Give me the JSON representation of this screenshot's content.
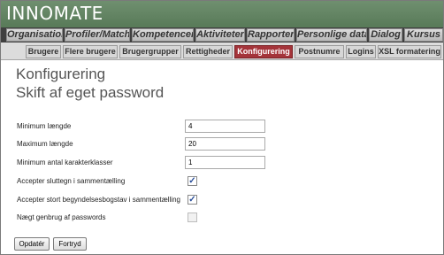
{
  "app": {
    "logo": "INNOMATE"
  },
  "main_nav": [
    {
      "label": "Organisation"
    },
    {
      "label": "Profiler/Match"
    },
    {
      "label": "Kompetencer"
    },
    {
      "label": "Aktiviteter"
    },
    {
      "label": "Rapporter"
    },
    {
      "label": "Personlige data"
    },
    {
      "label": "Dialog"
    },
    {
      "label": "Kursus"
    }
  ],
  "sub_nav": [
    {
      "label": "Brugere"
    },
    {
      "label": "Flere brugere"
    },
    {
      "label": "Brugergrupper"
    },
    {
      "label": "Rettigheder"
    },
    {
      "label": "Konfigurering",
      "active": true
    },
    {
      "label": "Postnumre"
    },
    {
      "label": "Logins"
    },
    {
      "label": "XSL formatering"
    }
  ],
  "page": {
    "title": "Konfigurering",
    "subtitle": "Skift af eget password"
  },
  "form": {
    "min_length": {
      "label": "Minimum længde",
      "value": "4"
    },
    "max_length": {
      "label": "Maximum længde",
      "value": "20"
    },
    "min_classes": {
      "label": "Minimum antal karakterklasser",
      "value": "1"
    },
    "accept_trailing": {
      "label": "Accepter sluttegn i sammentælling",
      "checked": true
    },
    "accept_capital": {
      "label": "Accepter stort begyndelsesbogstav i sammentælling",
      "checked": true
    },
    "deny_reuse": {
      "label": "Nægt genbrug af passwords",
      "checked": false,
      "disabled": true
    }
  },
  "buttons": {
    "update": "Opdatér",
    "cancel": "Fortryd"
  },
  "colors": {
    "header_green": "#5f815f",
    "active_tab": "#a4343a",
    "nav_dark": "#3f3f3f"
  }
}
